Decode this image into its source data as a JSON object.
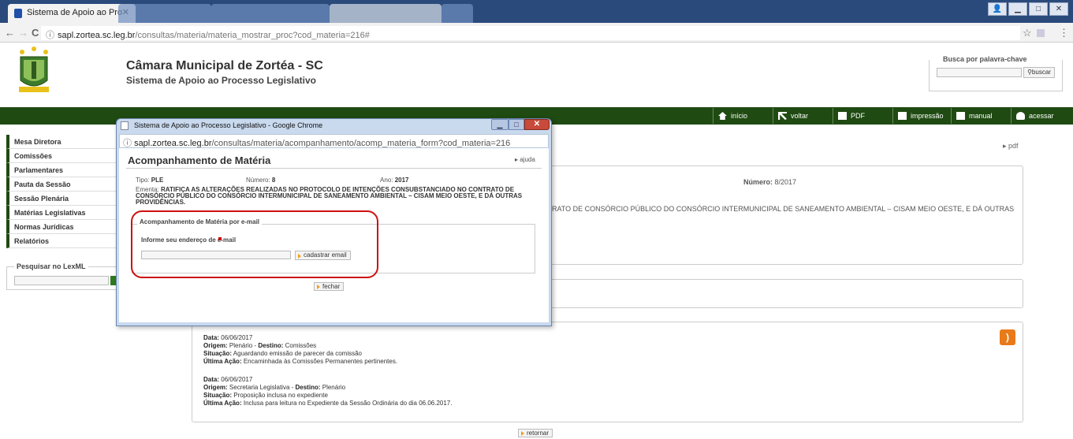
{
  "browser": {
    "active_tab_title": "Sistema de Apoio ao Pro",
    "url_domain": "sapl.zortea.sc.leg.br",
    "url_path": "/consultas/materia/materia_mostrar_proc?cod_materia=216#",
    "back": "←",
    "forward": "→",
    "reload": "C",
    "info": "ⓘ",
    "star": "☆",
    "menu": "⋮",
    "tab_close": "✕"
  },
  "header": {
    "title": "Câmara Municipal de Zortéa - SC",
    "subtitle": "Sistema de Apoio ao Processo Legislativo",
    "search_legend": "Busca por palavra-chave",
    "search_button": "buscar"
  },
  "topnav": [
    {
      "label": "início",
      "icon": "home-icon"
    },
    {
      "label": "voltar",
      "icon": "back-arrow-icon"
    },
    {
      "label": "PDF",
      "icon": "pdf-icon"
    },
    {
      "label": "impressão",
      "icon": "print-icon"
    },
    {
      "label": "manual",
      "icon": "help-icon"
    },
    {
      "label": "acessar",
      "icon": "user-icon"
    }
  ],
  "sidebar": {
    "items": [
      "Mesa Diretora",
      "Comissões",
      "Parlamentares",
      "Pauta da Sessão",
      "Sessão Plenária",
      "Matérias Legislativas",
      "Normas Jurídicas",
      "Relatórios"
    ],
    "lexml_legend": "Pesquisar no LexML"
  },
  "background": {
    "pdf_link": "pdf",
    "numero_label": "Número:",
    "numero_value": "8/2017",
    "ementa_fragment": "RATO DE CONSÓRCIO PÚBLICO DO CONSÓRCIO INTERMUNICIPAL DE SANEAMENTO AMBIENTAL – CISAM MEIO OESTE, E DÁ OUTRAS",
    "tramitacoes": [
      {
        "data": "06/06/2017",
        "origem": "Plenário",
        "destino": "Comissões",
        "situacao": "Aguardando emissão de parecer da comissão",
        "ultima_acao": "Encaminhada às Comissões Permanentes pertinentes."
      },
      {
        "data": "06/06/2017",
        "origem": "Secretaria Legislativa",
        "destino": "Plenário",
        "situacao": "Proposição inclusa no expediente",
        "ultima_acao": "Inclusa para leitura no Expediente da Sessão Ordinária do dia 06.06.2017."
      }
    ],
    "labels": {
      "data": "Data:",
      "origem": "Origem:",
      "destino": "Destino:",
      "situacao": "Situação:",
      "ultima_acao": "Última Ação:"
    },
    "retornar": "retornar"
  },
  "popup": {
    "window_title": "Sistema de Apoio ao Processo Legislativo - Google Chrome",
    "url_domain": "sapl.zortea.sc.leg.br",
    "url_path": "/consultas/materia/acompanhamento/acomp_materia_form?cod_materia=216",
    "heading": "Acompanhamento de Matéria",
    "ajuda": "ajuda",
    "tipo_label": "Tipo:",
    "tipo_value": "PLE",
    "numero_label": "Número:",
    "numero_value": "8",
    "ano_label": "Ano:",
    "ano_value": "2017",
    "ementa_label": "Ementa:",
    "ementa_value": "RATIFICA AS ALTERAÇÕES REALIZADAS NO PROTOCOLO DE INTENÇÕES CONSUBSTANCIADO NO CONTRATO DE CONSÓRCIO PÚBLICO DO CONSÓRCIO INTERMUNICIPAL DE SANEAMENTO AMBIENTAL – CISAM MEIO OESTE, E DÁ OUTRAS PROVIDÊNCIAS.",
    "fieldset_legend": "Acompanhamento de Matéria por e-mail",
    "email_label": "Informe seu endereço de e-mail",
    "email_value": "",
    "submit_label": "cadastrar email",
    "close_label": "fechar",
    "min": "▁",
    "max": "□",
    "close": "✕"
  },
  "colors": {
    "nav_green": "#1f4a12",
    "highlight_red": "#cc1111",
    "rss_orange": "#e87a19"
  }
}
